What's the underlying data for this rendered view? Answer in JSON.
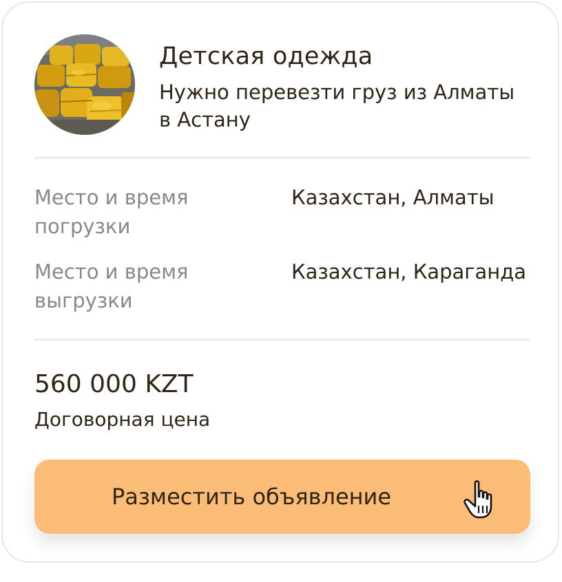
{
  "listing": {
    "title": "Детская одежда",
    "subtitle": "Нужно перевезти груз из Алматы в Астану",
    "image": "cargo-bales-photo"
  },
  "details": [
    {
      "label": "Место и время погрузки",
      "value": "Казахстан, Алматы"
    },
    {
      "label": "Место и время выгрузки",
      "value": "Казахстан, Караганда"
    }
  ],
  "price": {
    "amount": "560 000 KZT",
    "note": "Договорная цена"
  },
  "cta": {
    "label": "Разместить объявление",
    "cursor_icon": "hand-pointer-icon"
  },
  "colors": {
    "accent": "#fbbc78",
    "text": "#2f2416",
    "muted": "#888888",
    "divider": "#ebebeb"
  }
}
